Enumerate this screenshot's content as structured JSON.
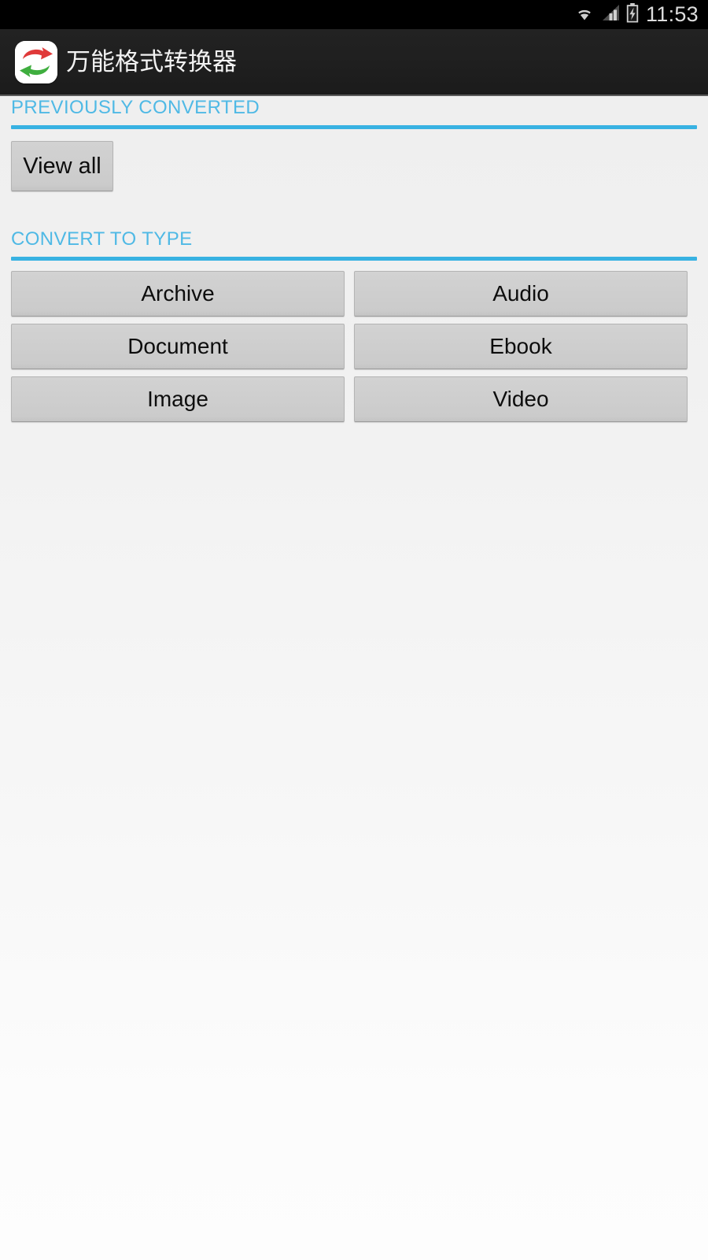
{
  "status_bar": {
    "clock": "11:53",
    "icons": [
      {
        "name": "wifi-icon",
        "label": "wifi"
      },
      {
        "name": "cellular-signal-icon",
        "label": "signal"
      },
      {
        "name": "battery-charging-icon",
        "label": "battery charging"
      }
    ]
  },
  "action_bar": {
    "app_icon_name": "app-logo-convert-arrows-icon",
    "title": "万能格式转换器"
  },
  "previously_converted": {
    "header": "PREVIOUSLY CONVERTED",
    "view_all_label": "View all"
  },
  "convert_to_type": {
    "header": "CONVERT TO TYPE",
    "types": [
      {
        "label": "Archive"
      },
      {
        "label": "Audio"
      },
      {
        "label": "Document"
      },
      {
        "label": "Ebook"
      },
      {
        "label": "Image"
      },
      {
        "label": "Video"
      }
    ]
  },
  "colors": {
    "accent_blue": "#38b2e2",
    "header_text_blue": "#4fb9e5",
    "status_bar_bg": "#000000",
    "action_bar_bg": "#1f1f1f",
    "button_face": "#cecece",
    "page_bg_top": "#eeeeee",
    "page_bg_bottom": "#fdfdfd",
    "icon_arrow_red": "#e03a3a",
    "icon_arrow_green": "#3fae3f"
  }
}
